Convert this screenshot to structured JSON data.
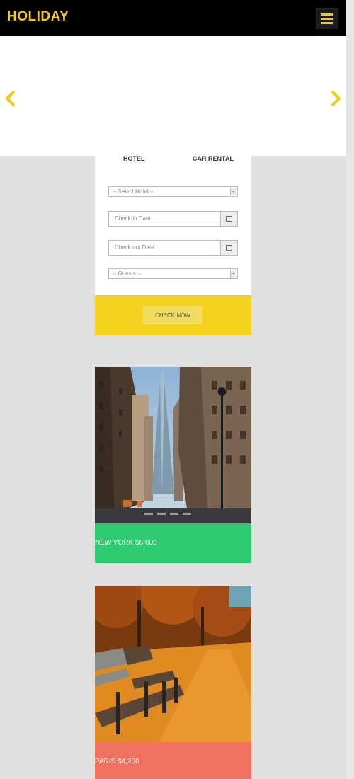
{
  "header": {
    "brand": "HOLIDAY",
    "brand_color": "#f4c910",
    "menu_icon": "hamburger-menu-icon"
  },
  "carousel": {
    "prev_icon": "chevron-left-icon",
    "next_icon": "chevron-right-icon",
    "arrow_color": "#f4c910"
  },
  "booking": {
    "tabs": [
      "HOTEL",
      "CAR RENTAL"
    ],
    "hotel_select": "-- Select Hotel --",
    "checkin_placeholder": "Check-in Date",
    "checkout_placeholder": "Check-out Date",
    "guests_select": "-- Guests --",
    "calendar_icon": "calendar-icon",
    "check_button": "CHECK NOW",
    "band_color": "#f4d21f"
  },
  "destinations": [
    {
      "label": "NEW YORK $6,600",
      "color": "#2ecc71",
      "image": "city-street-skyscraper-photo"
    },
    {
      "label": "PARIS $4,200",
      "color": "#ef7260",
      "image": "autumn-park-benches-photo"
    }
  ]
}
